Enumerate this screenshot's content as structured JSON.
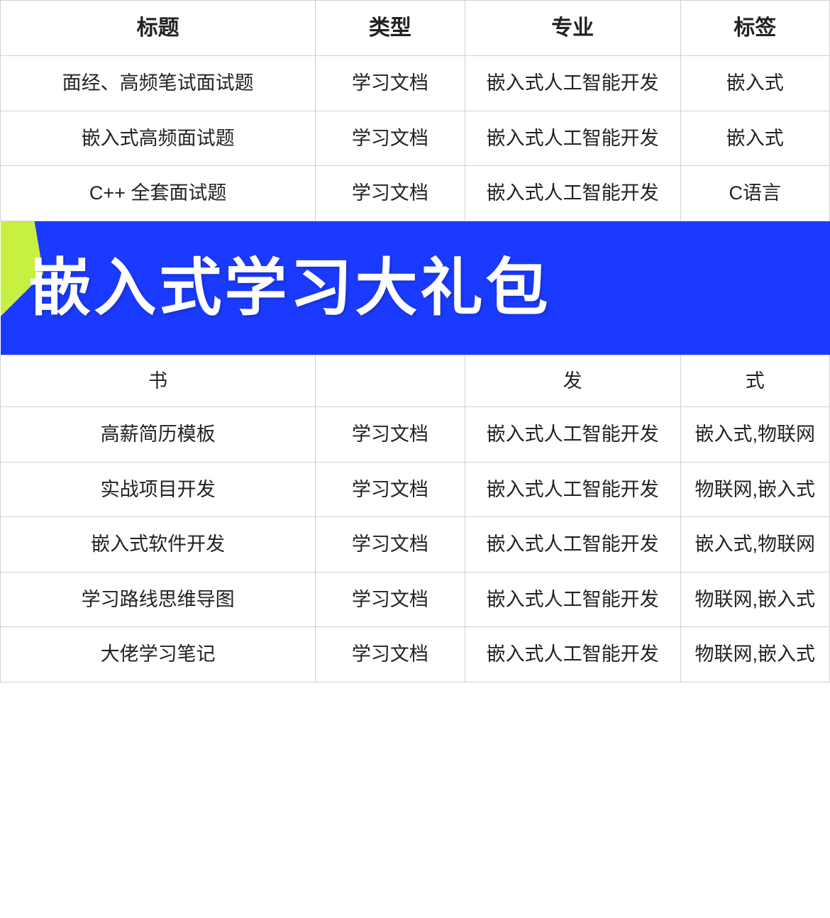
{
  "table": {
    "headers": [
      "标题",
      "类型",
      "专业",
      "标签"
    ],
    "rows": [
      {
        "title": "面经、高频笔试面试题",
        "type": "学习文档",
        "major": "嵌入式人工智能开发",
        "tag": "嵌入式"
      },
      {
        "title": "嵌入式高频面试题",
        "type": "学习文档",
        "major": "嵌入式人工智能开发",
        "tag": "嵌入式"
      },
      {
        "title": "C++ 全套面试题",
        "type": "学习文档",
        "major": "嵌入式人工智能开发",
        "tag": "C语言"
      }
    ],
    "partial_row": {
      "title": "书",
      "major": "发",
      "tag": "式"
    },
    "rows_after_banner": [
      {
        "title": "高薪简历模板",
        "type": "学习文档",
        "major": "嵌入式人工智能开发",
        "tag": "嵌入式,物联网"
      },
      {
        "title": "实战项目开发",
        "type": "学习文档",
        "major": "嵌入式人工智能开发",
        "tag": "物联网,嵌入式"
      },
      {
        "title": "嵌入式软件开发",
        "type": "学习文档",
        "major": "嵌入式人工智能开发",
        "tag": "嵌入式,物联网"
      },
      {
        "title": "学习路线思维导图",
        "type": "学习文档",
        "major": "嵌入式人工智能开发",
        "tag": "物联网,嵌入式"
      },
      {
        "title": "大佬学习笔记",
        "type": "学习文档",
        "major": "嵌入式人工智能开发",
        "tag": "物联网,嵌入式"
      }
    ],
    "banner_text": "嵌入式学习大礼包"
  }
}
